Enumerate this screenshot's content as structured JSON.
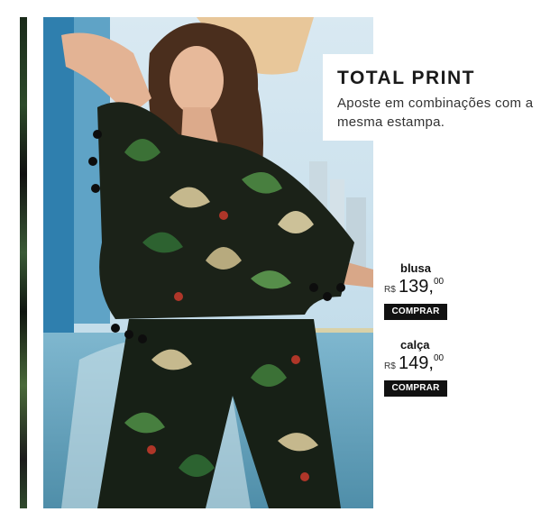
{
  "promo": {
    "title": "TOTAL PRINT",
    "subtitle": "Aposte em combinações com a mesma estampa."
  },
  "products": [
    {
      "name": "blusa",
      "currency": "R$",
      "price_integer": "139,",
      "price_decimal": "00",
      "button_label": "COMPRAR"
    },
    {
      "name": "calça",
      "currency": "R$",
      "price_integer": "149,",
      "price_decimal": "00",
      "button_label": "COMPRAR"
    }
  ]
}
